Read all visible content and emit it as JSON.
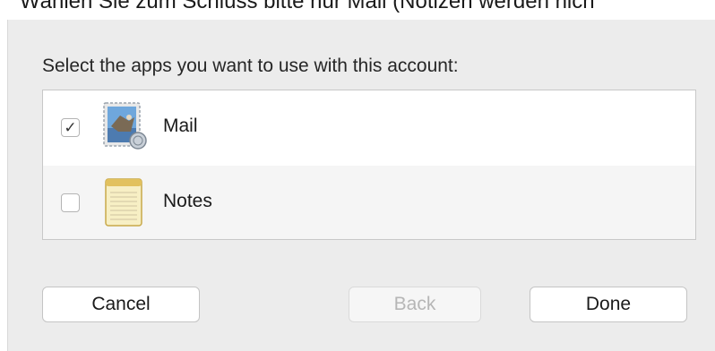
{
  "caption": "Wählen Sie zum Schluss bitte nur Mail (Notizen werden nich",
  "dialog": {
    "prompt": "Select the apps you want to use with this account:",
    "apps": [
      {
        "name": "Mail",
        "checked": true,
        "check_glyph": "✓",
        "icon": "mail-stamp-icon"
      },
      {
        "name": "Notes",
        "checked": false,
        "check_glyph": "",
        "icon": "notes-icon"
      }
    ],
    "buttons": {
      "cancel": "Cancel",
      "back": "Back",
      "done": "Done"
    }
  }
}
